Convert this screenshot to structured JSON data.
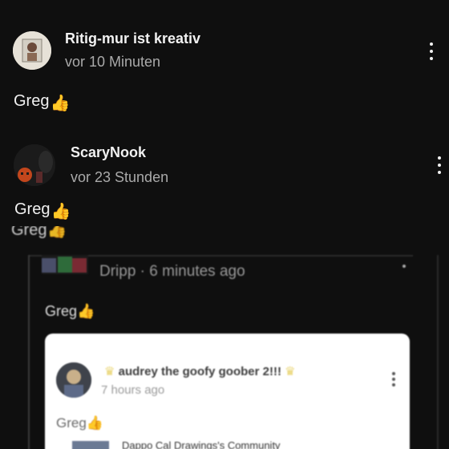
{
  "comments": [
    {
      "author": "Ritig-mur ist kreativ",
      "time": "vor 10 Minuten",
      "text": "Greg",
      "emoji": "👍"
    },
    {
      "author": "ScaryNook",
      "time": "vor 23 Stunden",
      "text": "Greg",
      "emoji": "👍"
    }
  ],
  "embedded": {
    "partial_text": "Greg",
    "reply_meta": "Dripp · 6 minutes ago",
    "reply_text": "Greg",
    "emoji": "👍",
    "card": {
      "author": "audrey the goofy goober 2!!!",
      "time": "7 hours ago",
      "text": "Greg",
      "community": "Dappo Cal Drawings's Community"
    }
  },
  "colors": {
    "background": "#0f0f0f",
    "primary_text": "#f1f1f1",
    "secondary_text": "#aaaaaa"
  }
}
